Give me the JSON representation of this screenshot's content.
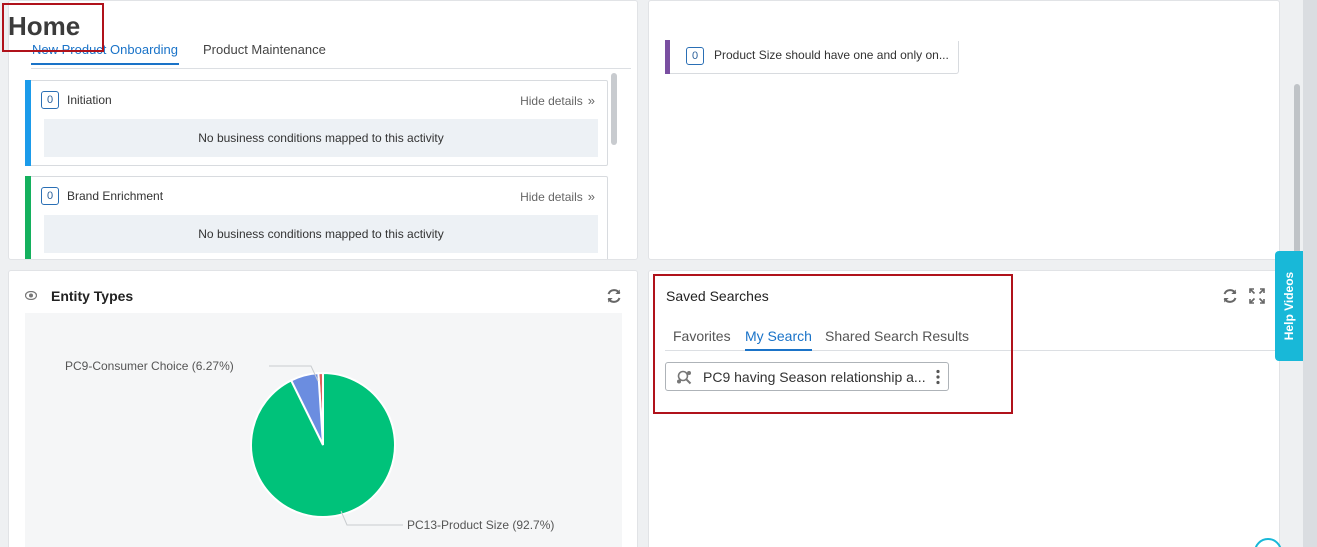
{
  "page": {
    "title": "Home"
  },
  "workflow": {
    "tabs": [
      {
        "label": "New Product Onboarding",
        "active": true
      },
      {
        "label": "Product Maintenance",
        "active": false
      }
    ],
    "activities": [
      {
        "count": "0",
        "name": "Initiation",
        "toggle": "Hide details",
        "message": "No business conditions mapped to this activity",
        "color": "#1b9bea"
      },
      {
        "count": "0",
        "name": "Brand Enrichment",
        "toggle": "Hide details",
        "message": "No business conditions mapped to this activity",
        "color": "#14b05d"
      }
    ]
  },
  "business_condition": {
    "count": "0",
    "text": "Product Size should have one and only on...",
    "color": "#7a4fa1"
  },
  "entity_types": {
    "title": "Entity Types",
    "icons": {
      "header": "eye-icon",
      "refresh": "refresh-icon"
    }
  },
  "chart_data": {
    "type": "pie",
    "title": "",
    "slices": [
      {
        "label": "PC13-Product Size (92.7%)",
        "name": "PC13-Product Size",
        "value": 92.7,
        "color": "#00c27a"
      },
      {
        "label": "PC9-Consumer Choice (6.27%)",
        "name": "PC9-Consumer Choice",
        "value": 6.27,
        "color": "#6b8de0"
      },
      {
        "label": "",
        "name": "other",
        "value": 1.03,
        "color": "#e0605a"
      }
    ]
  },
  "saved_searches": {
    "title": "Saved Searches",
    "tabs": [
      {
        "label": "Favorites",
        "active": false
      },
      {
        "label": "My Search",
        "active": true
      },
      {
        "label": "Shared Search Results",
        "active": false
      }
    ],
    "items": [
      {
        "label": "PC9 having Season relationship a...",
        "icon": "shared-search-icon"
      }
    ],
    "icons": {
      "refresh": "refresh-icon",
      "expand": "expand-icon"
    }
  },
  "help": {
    "label": "Help Videos"
  },
  "colors": {
    "accent": "#1a73c8",
    "help": "#18b8d8",
    "annotation": "#b0121b"
  }
}
